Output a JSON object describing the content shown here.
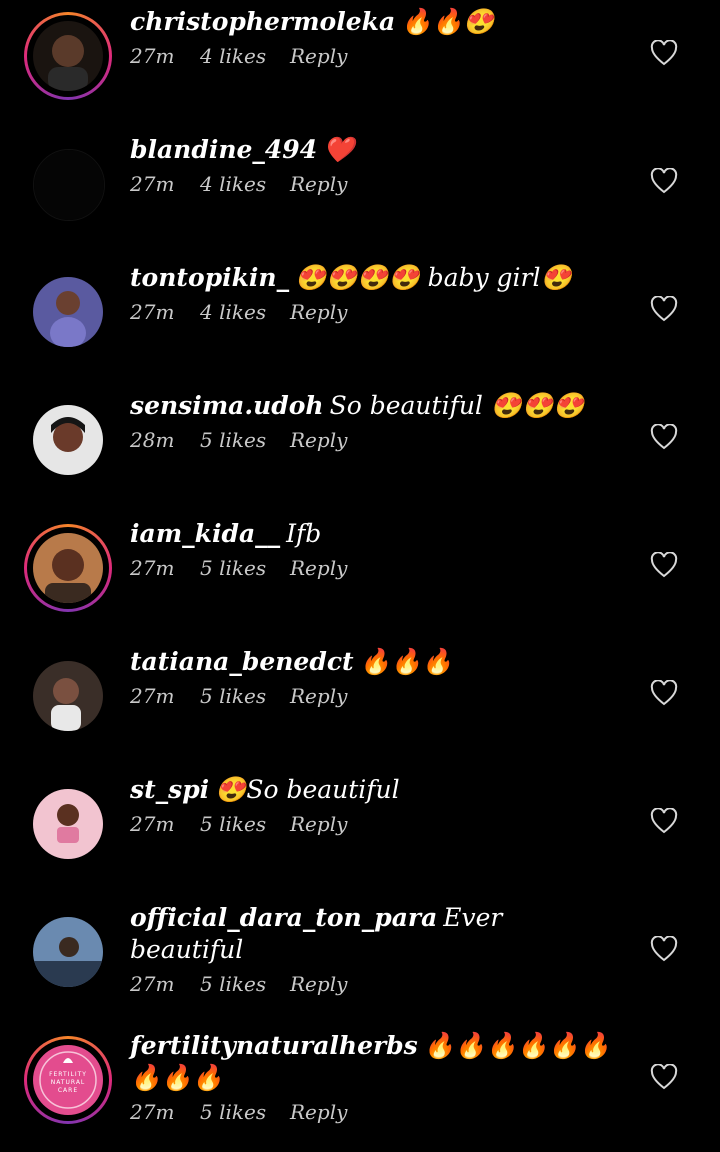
{
  "comments": [
    {
      "username": "christophermoleka",
      "text": "🔥🔥😍",
      "time": "27m",
      "likes": "4 likes",
      "reply": "Reply",
      "ring": true,
      "avatar_color": "#5a3a2a",
      "heart_icon": "heart-outline-icon"
    },
    {
      "username": "blandine_494",
      "text": "❤️",
      "time": "27m",
      "likes": "4 likes",
      "reply": "Reply",
      "ring": false,
      "avatar_color": "#0a0a0a",
      "heart_icon": "heart-outline-icon"
    },
    {
      "username": "tontopikin_",
      "text": "😍😍😍😍 baby girl😍",
      "time": "27m",
      "likes": "4 likes",
      "reply": "Reply",
      "ring": false,
      "avatar_color": "#6a6aa8",
      "heart_icon": "heart-outline-icon"
    },
    {
      "username": "sensima.udoh",
      "text": "So beautiful 😍😍😍",
      "time": "28m",
      "likes": "5 likes",
      "reply": "Reply",
      "ring": false,
      "avatar_color": "#d8d8d8",
      "heart_icon": "heart-outline-icon"
    },
    {
      "username": "iam_kida__",
      "text": "Ifb",
      "time": "27m",
      "likes": "5 likes",
      "reply": "Reply",
      "ring": true,
      "avatar_color": "#6a3a22",
      "heart_icon": "heart-outline-icon"
    },
    {
      "username": "tatiana_benedct",
      "text": "🔥🔥🔥",
      "time": "27m",
      "likes": "5 likes",
      "reply": "Reply",
      "ring": false,
      "avatar_color": "#4a3a30",
      "heart_icon": "heart-outline-icon"
    },
    {
      "username": "st_spi",
      "text": "😍So beautiful",
      "time": "27m",
      "likes": "5 likes",
      "reply": "Reply",
      "ring": false,
      "avatar_color": "#f3c6d2",
      "heart_icon": "heart-outline-icon"
    },
    {
      "username": "official_dara_ton_para",
      "text": "Ever beautiful",
      "time": "27m",
      "likes": "5 likes",
      "reply": "Reply",
      "ring": false,
      "avatar_color": "#3a5a7a",
      "heart_icon": "heart-outline-icon"
    },
    {
      "username": "fertilitynaturalherbs",
      "text": "🔥🔥🔥🔥🔥🔥🔥🔥🔥",
      "time": "27m",
      "likes": "5 likes",
      "reply": "Reply",
      "ring": true,
      "avatar_color": "#e34c8e",
      "avatar_text": "FERTILITY NATURAL CARE",
      "heart_icon": "heart-outline-icon"
    }
  ]
}
